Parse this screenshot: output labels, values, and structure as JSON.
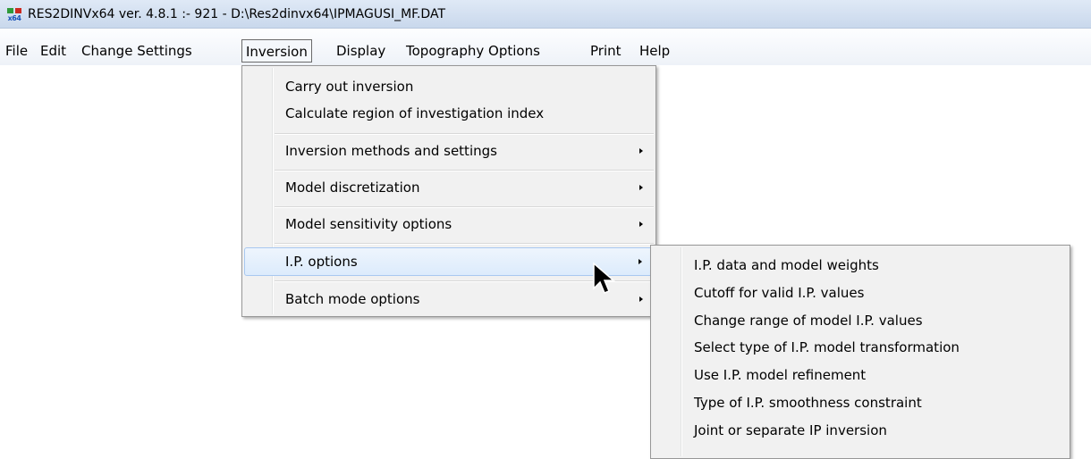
{
  "window": {
    "title": "RES2DINVx64 ver. 4.8.1 :- 921 - D:\\Res2dinvx64\\IPMAGUSI_MF.DAT",
    "icon_text": "x64"
  },
  "menubar": {
    "items": [
      "File",
      "Edit",
      "Change Settings",
      "Inversion",
      "Display",
      "Topography Options",
      "Print",
      "Help"
    ],
    "active": "Inversion"
  },
  "inversion_menu": {
    "items": [
      "Carry out inversion",
      "Calculate region of investigation index",
      "Inversion methods and settings",
      "Model discretization",
      "Model sensitivity options",
      "I.P. options",
      "Batch mode options"
    ],
    "highlighted": "I.P. options"
  },
  "ip_submenu": {
    "items": [
      "I.P. data and model weights",
      "Cutoff for valid I.P. values",
      "Change range of model I.P. values",
      "Select type of I.P. model transformation",
      "Use I.P. model refinement",
      "Type of I.P. smoothness constraint",
      "Joint or separate IP inversion"
    ]
  },
  "colors": {
    "menu_bg": "#f1f1f1",
    "highlight_bg": "#dcebfc",
    "highlight_border": "#a8c8f0",
    "titlebar": "#c9d8ec"
  },
  "icons": [
    "app-icon",
    "submenu-arrow-icon",
    "mouse-cursor-icon"
  ]
}
